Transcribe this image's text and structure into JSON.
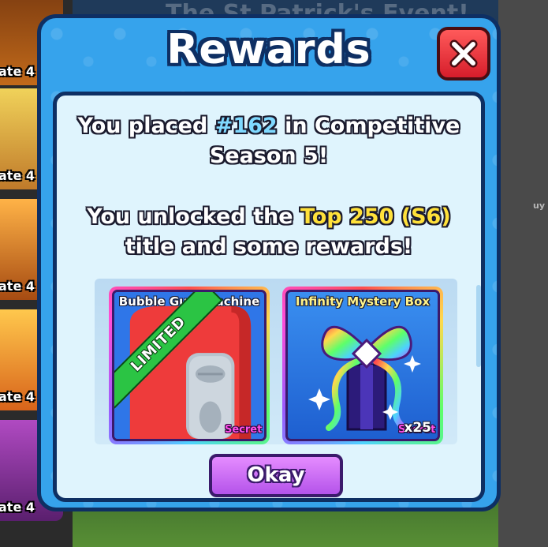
{
  "background": {
    "event_title": "The St Patrick's Event!",
    "side_cards": [
      {
        "label": "ate 4"
      },
      {
        "label": "ate 4"
      },
      {
        "label": "ate 4"
      },
      {
        "label": "ate 4"
      },
      {
        "label": "ate 4"
      }
    ],
    "right_snippet": "uy"
  },
  "modal": {
    "title": "Rewards",
    "close_icon": "close-icon",
    "message1": {
      "prefix": "You placed ",
      "rank": "#162",
      "suffix": " in Competitive",
      "line2": "Season 5!"
    },
    "message2": {
      "prefix": "You unlocked the ",
      "title_unlocked": "Top 250 (S6)",
      "line2": "title and some rewards!"
    },
    "rewards": [
      {
        "name": "Bubble Gum Machine",
        "badge": "LIMITED",
        "rarity": "Secret",
        "icon": "bubble-gum-machine-icon"
      },
      {
        "name": "Infinity Mystery Box",
        "rarity": "Secret",
        "quantity": "x25",
        "icon": "infinity-mystery-box-icon"
      }
    ],
    "okay_label": "Okay"
  },
  "colors": {
    "modal_blue": "#36a3ec",
    "outline_navy": "#0e2f63",
    "close_red": "#d61d2b",
    "okay_purple": "#b453ea",
    "rank_blue": "#7fd9ff",
    "title_yellow": "#ffe13a",
    "limited_green": "#2bc444",
    "secret_pink": "#ff4fe8"
  }
}
